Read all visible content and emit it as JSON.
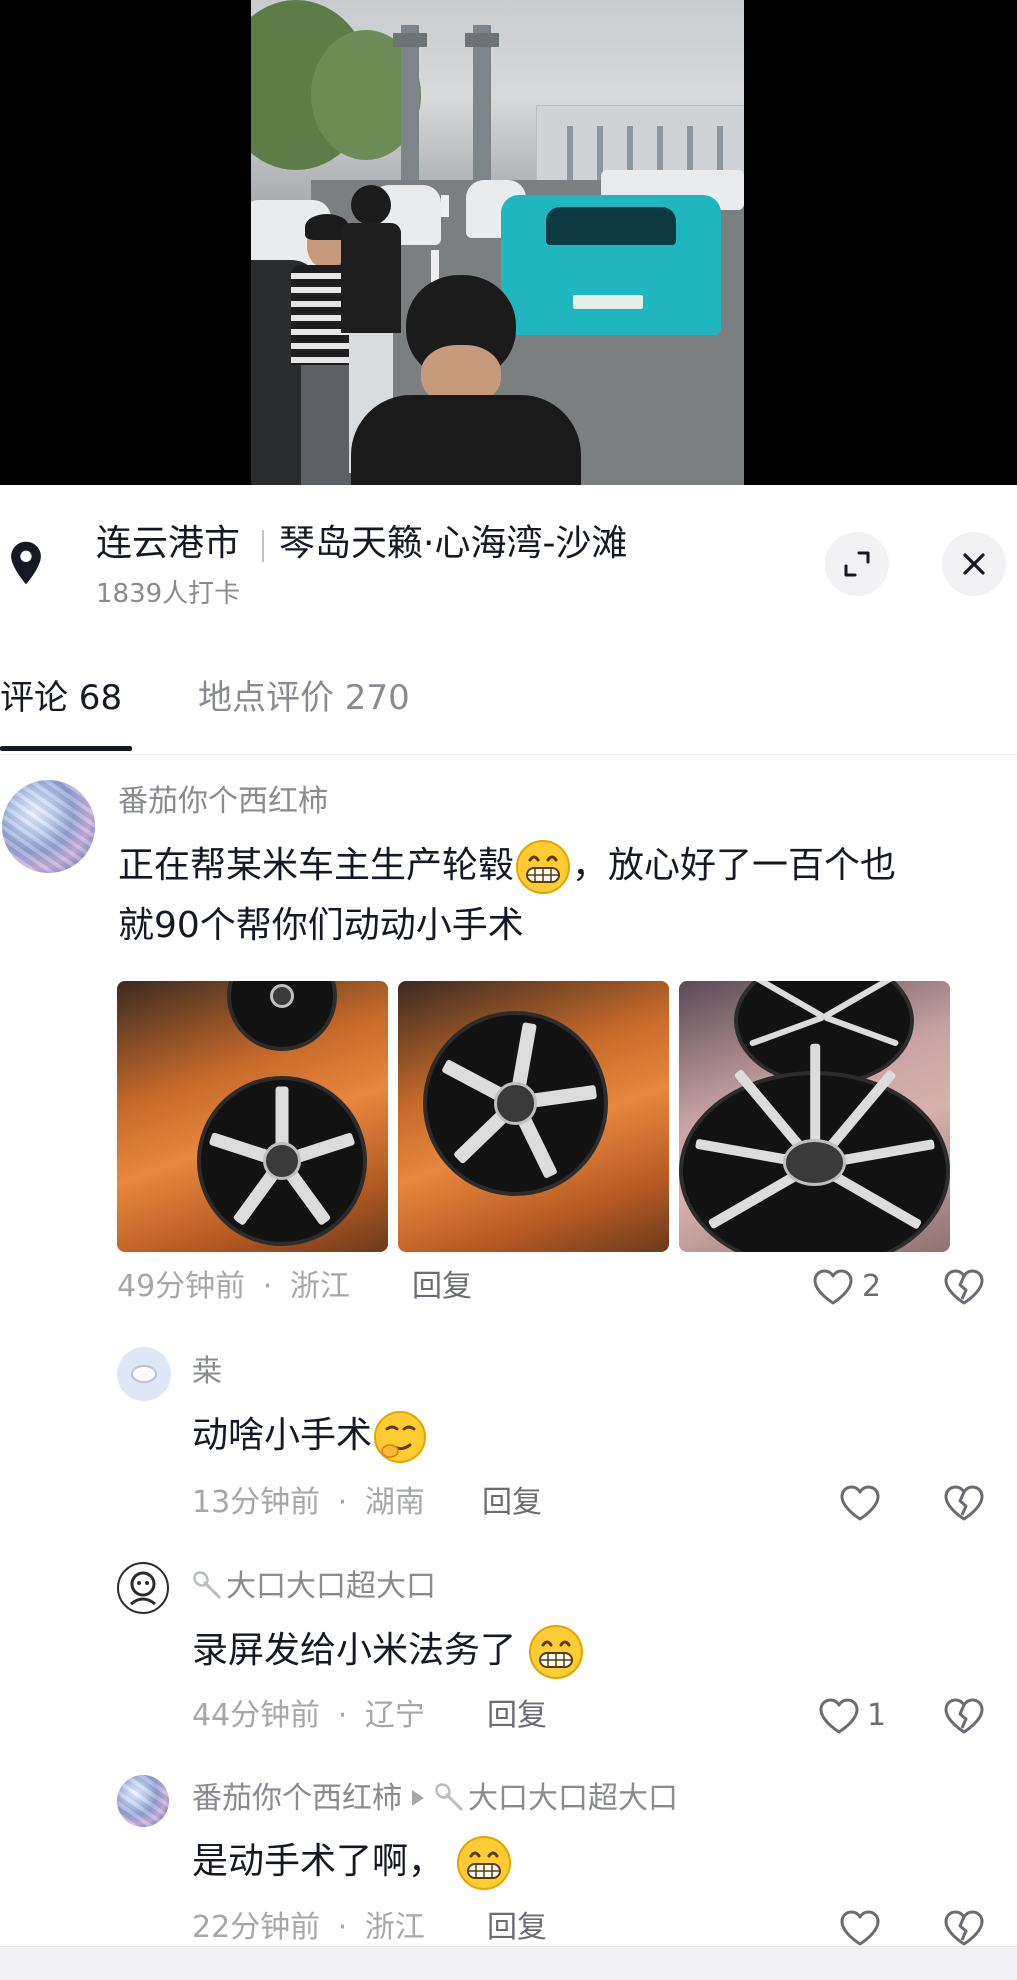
{
  "location": {
    "city": "连云港市",
    "place": "琴岛天籁·心海湾-沙滩",
    "checkins": "1839人打卡"
  },
  "tabs": [
    {
      "label": "评论 68",
      "active": true
    },
    {
      "label": "地点评价 270",
      "active": false
    }
  ],
  "comments": [
    {
      "user": "番茄你个西红柿",
      "text_before_emoji": "正在帮某米车主生产轮毂",
      "text_after_emoji": "，放心好了一百个也",
      "text_line2": "就90个帮你们动动小手术",
      "time": "49分钟前",
      "region": "浙江",
      "reply": "回复",
      "likes": "2",
      "photos": [
        "wheel-photo-1",
        "wheel-photo-2",
        "wheel-photo-3"
      ]
    },
    {
      "user": "桒",
      "text": "动啥小手术",
      "time": "13分钟前",
      "region": "湖南",
      "reply": "回复",
      "likes": ""
    },
    {
      "user": "大口大口超大口",
      "text": "录屏发给小米法务了",
      "time": "44分钟前",
      "region": "辽宁",
      "reply": "回复",
      "likes": "1"
    },
    {
      "user": "番茄你个西红柿",
      "reply_to": "大口大口超大口",
      "text": "是动手术了啊，",
      "time": "22分钟前",
      "region": "浙江",
      "reply": "回复",
      "likes": ""
    }
  ],
  "meta_separator": "·",
  "icons": {
    "location": "location-pin-icon",
    "expand": "expand-icon",
    "close": "close-icon",
    "like": "heart-icon",
    "dislike": "broken-heart-icon",
    "emoji_grin": "grinning-emoji",
    "emoji_thinking": "smirk-emoji"
  },
  "colors": {
    "primary_text": "#161823",
    "secondary_text": "#8a8b91",
    "meta_text": "#a6a7ab"
  }
}
